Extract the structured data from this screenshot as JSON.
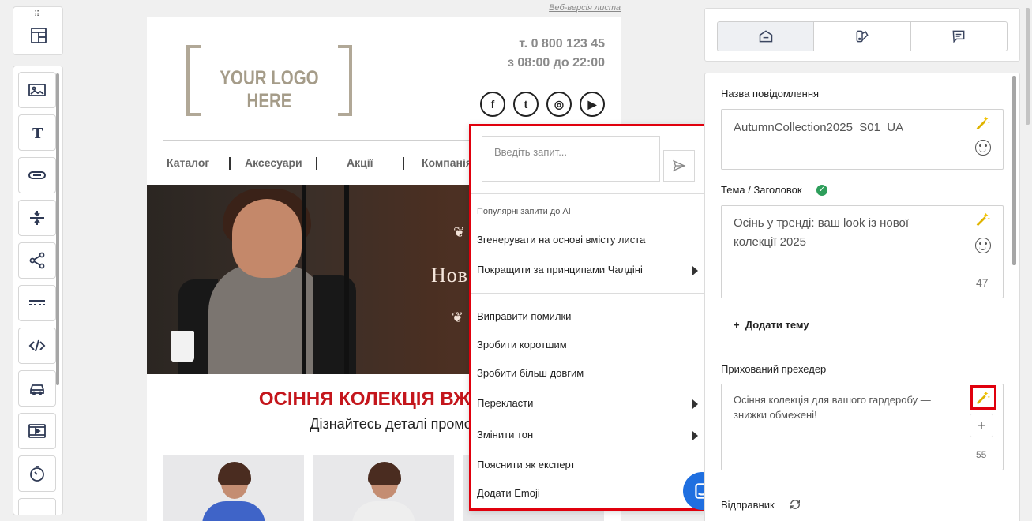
{
  "email": {
    "web_version_link": "Веб-версія листа",
    "logo_text": "YOUR LOGO HERE",
    "phone_line1": "т. 0 800 123 45",
    "phone_line2": "з 08:00 до 22:00",
    "socials": [
      "f",
      "t",
      "◎",
      "▶"
    ],
    "nav": [
      "Каталог",
      "Аксесуари",
      "Акції",
      "Компанія"
    ],
    "hero_title": "Нов",
    "promo_title": "ОСІННЯ КОЛЕКЦІЯ ВЖЕ В М",
    "promo_subtitle": "Дізнайтесь деталі промоак"
  },
  "ai_popup": {
    "placeholder": "Введіть запит...",
    "section_title": "Популярні запити до AI",
    "items": [
      {
        "label": "Згенерувати на основі вмісту листа",
        "submenu": false
      },
      {
        "label": "Покращити за принципами Чалдіні",
        "submenu": true
      },
      {
        "label": "Виправити помилки",
        "submenu": false
      },
      {
        "label": "Зробити коротшим",
        "submenu": false
      },
      {
        "label": "Зробити більш довгим",
        "submenu": false
      },
      {
        "label": "Перекласти",
        "submenu": true
      },
      {
        "label": "Змінити тон",
        "submenu": true
      },
      {
        "label": "Пояснити як експерт",
        "submenu": false
      },
      {
        "label": "Додати Emoji",
        "submenu": false
      }
    ]
  },
  "right_panel": {
    "message_name_label": "Назва повідомлення",
    "message_name_value": "AutumnCollection2025_S01_UA",
    "subject_label": "Тема / Заголовок",
    "subject_value": "Осінь у тренді: ваш look із нової колекції 2025",
    "subject_count": "47",
    "add_subject": "Додати тему",
    "preheader_label": "Прихований прехедер",
    "preheader_value": "Осіння колекція для вашого гардеробу — знижки обмежені!",
    "preheader_count": "55",
    "sender_label": "Відправник"
  },
  "colors": {
    "accent_red": "#e0000d",
    "promo_red": "#c4161c",
    "chat_blue": "#1f6fe0",
    "wand_yellow": "#f2c200"
  }
}
